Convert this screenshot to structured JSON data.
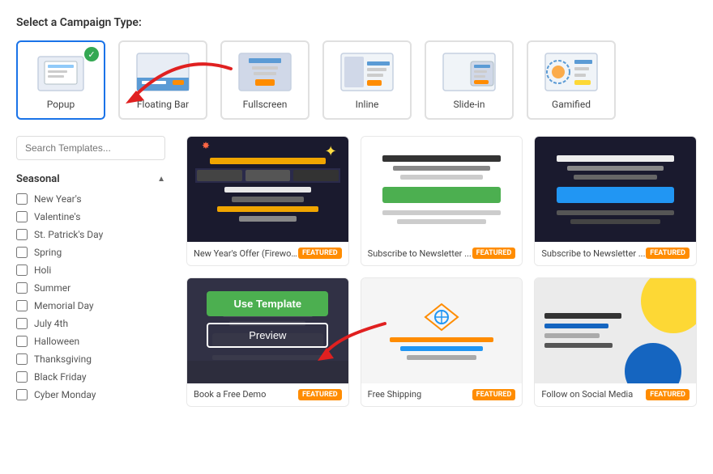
{
  "page": {
    "section_title": "Select a Campaign Type:",
    "campaign_types": [
      {
        "id": "popup",
        "label": "Popup",
        "selected": true
      },
      {
        "id": "floating-bar",
        "label": "Floating Bar",
        "selected": false
      },
      {
        "id": "fullscreen",
        "label": "Fullscreen",
        "selected": false
      },
      {
        "id": "inline",
        "label": "Inline",
        "selected": false
      },
      {
        "id": "slide-in",
        "label": "Slide-in",
        "selected": false
      },
      {
        "id": "gamified",
        "label": "Gamified",
        "selected": false
      }
    ],
    "search_placeholder": "Search Templates...",
    "sidebar": {
      "section_label": "Seasonal",
      "items": [
        {
          "id": "new-years",
          "label": "New Year's"
        },
        {
          "id": "valentines",
          "label": "Valentine's"
        },
        {
          "id": "st-patricks",
          "label": "St. Patrick's Day"
        },
        {
          "id": "spring",
          "label": "Spring"
        },
        {
          "id": "holi",
          "label": "Holi"
        },
        {
          "id": "summer",
          "label": "Summer"
        },
        {
          "id": "memorial-day",
          "label": "Memorial Day"
        },
        {
          "id": "july-4th",
          "label": "July 4th"
        },
        {
          "id": "halloween",
          "label": "Halloween"
        },
        {
          "id": "thanksgiving",
          "label": "Thanksgiving"
        },
        {
          "id": "black-friday",
          "label": "Black Friday"
        },
        {
          "id": "cyber-monday",
          "label": "Cyber Monday"
        }
      ]
    },
    "templates": [
      {
        "id": "t1",
        "name": "New Year's Offer (Firewo...",
        "featured": true,
        "hovered": false,
        "type": "newyear"
      },
      {
        "id": "t2",
        "name": "Subscribe to Newsletter ...",
        "featured": true,
        "hovered": false,
        "type": "subscribe1"
      },
      {
        "id": "t3",
        "name": "Subscribe to Newsletter ...",
        "featured": true,
        "hovered": false,
        "type": "subscribe2"
      },
      {
        "id": "t4",
        "name": "Book a Free Demo",
        "featured": true,
        "hovered": true,
        "type": "demo"
      },
      {
        "id": "t5",
        "name": "Free Shipping",
        "featured": true,
        "hovered": false,
        "type": "shipping"
      },
      {
        "id": "t6",
        "name": "Follow on Social Media",
        "featured": true,
        "hovered": false,
        "type": "social"
      }
    ],
    "buttons": {
      "use_template": "Use Template",
      "preview": "Preview"
    },
    "featured_label": "FEATURED"
  }
}
